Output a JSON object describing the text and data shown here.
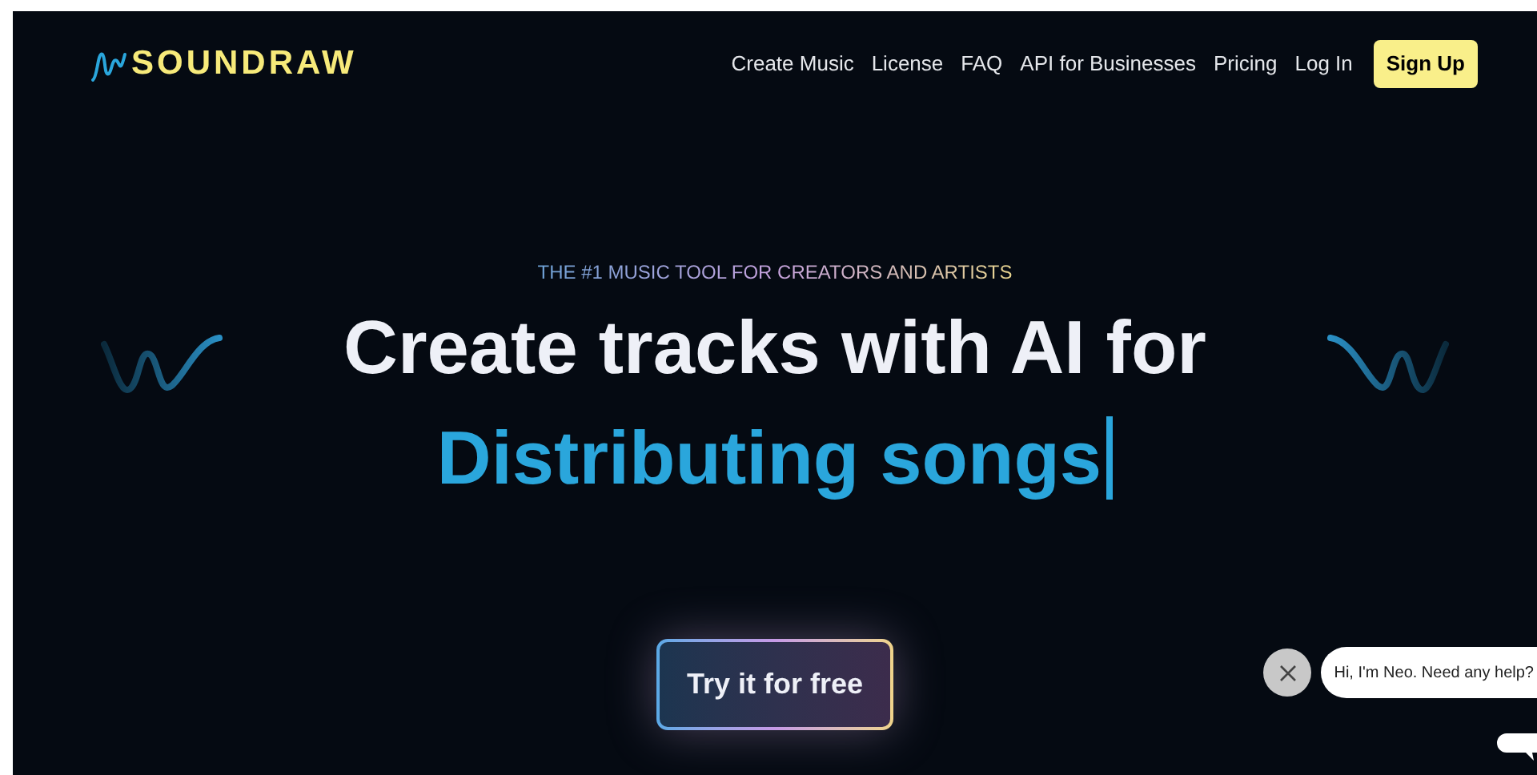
{
  "logo": {
    "text": "SOUNDRAW"
  },
  "nav": [
    "Create Music",
    "License",
    "FAQ",
    "API for Businesses",
    "Pricing",
    "Log In"
  ],
  "signup": "Sign Up",
  "hero": {
    "tagline": "THE #1 MUSIC TOOL FOR CREATORS AND ARTISTS",
    "heading": "Create tracks with AI for",
    "typed": "Distributing songs",
    "cta": "Try it for free"
  },
  "chat": {
    "message": "Hi, I'm Neo. Need any help?"
  }
}
